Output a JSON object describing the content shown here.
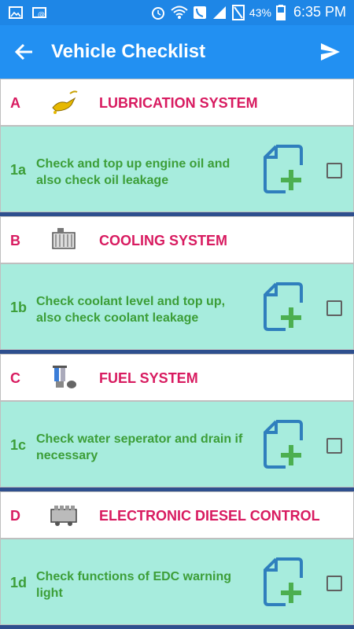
{
  "status_bar": {
    "battery": "43%",
    "time": "6:35 PM"
  },
  "app_bar": {
    "title": "Vehicle Checklist"
  },
  "sections": [
    {
      "letter": "A",
      "name": "LUBRICATION SYSTEM",
      "item": {
        "number": "1a",
        "text": "Check and top up engine oil and also check oil leakage"
      }
    },
    {
      "letter": "B",
      "name": "COOLING SYSTEM",
      "item": {
        "number": "1b",
        "text": "Check coolant level and top up, also check coolant leakage"
      }
    },
    {
      "letter": "C",
      "name": "FUEL SYSTEM",
      "item": {
        "number": "1c",
        "text": "Check water seperator and drain if necessary"
      }
    },
    {
      "letter": "D",
      "name": "ELECTRONIC DIESEL CONTROL",
      "item": {
        "number": "1d",
        "text": "Check functions of EDC warning light"
      }
    }
  ],
  "colors": {
    "app_bar": "#2290F2",
    "status_bar": "#1E86E6",
    "section_text": "#D81B60",
    "item_background": "#A7ECDD",
    "item_text": "#3C9E38",
    "add_file_icon": "#2F7FBD",
    "add_file_plus": "#4CAF50"
  }
}
